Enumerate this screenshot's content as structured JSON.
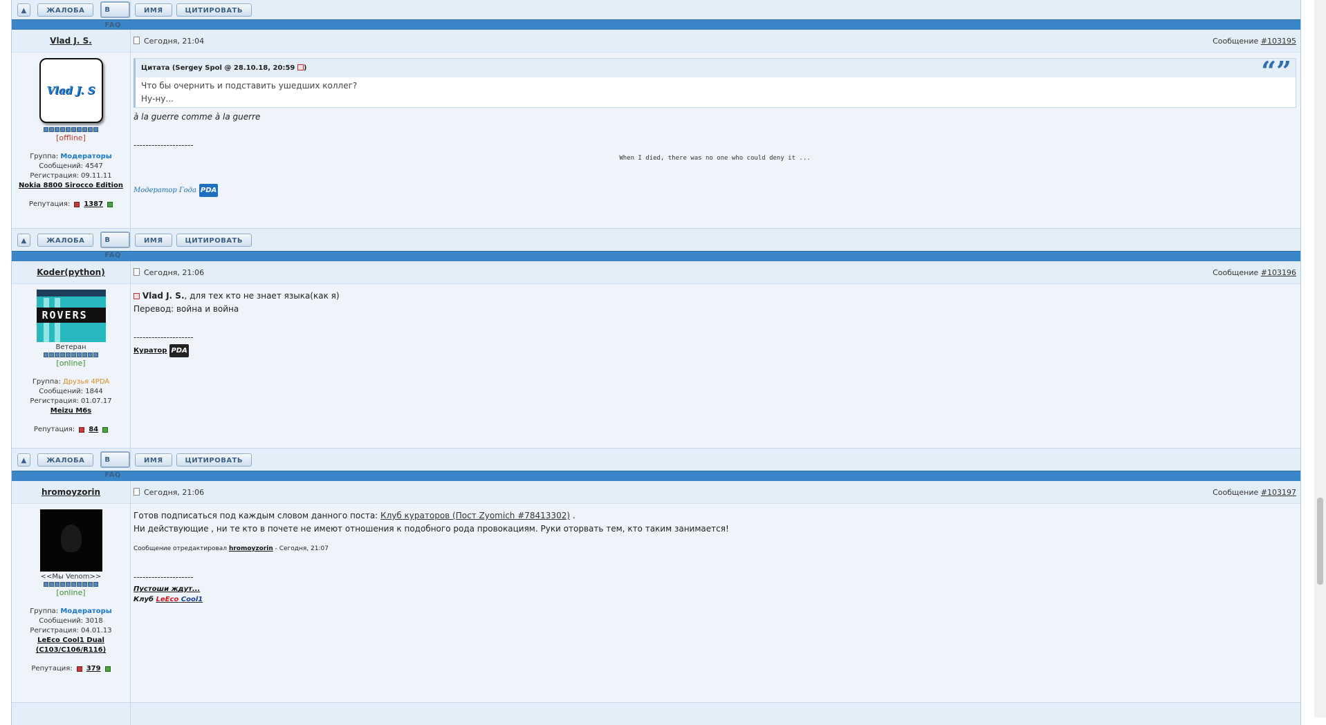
{
  "actions": {
    "up": "▲",
    "complain": "ЖАЛОБА",
    "faq": "В FAQ",
    "name": "ИМЯ",
    "quote": "ЦИТИРОВАТЬ"
  },
  "posts": [
    {
      "author": "Vlad J. S.",
      "date": "Сегодня, 21:04",
      "msg_label": "Сообщение",
      "msg_num": "#103195",
      "avatar_text": "Vlad J. S",
      "status": "[offline]",
      "group_label": "Группа:",
      "group": "Модераторы",
      "messages": "Сообщений: 4547",
      "registered": "Регистрация: 09.11.11",
      "device": "Nokia 8800 Sirocco Edition",
      "rep_label": "Репутация:",
      "rep": "1387",
      "quote_head": "Цитата (Sergey Spol @ 28.10.18, 20:59",
      "quote_line1": "Что бы очернить и подставить ушедших коллег?",
      "quote_line2": "Ну-ну...",
      "text": "à la guerre comme à la guerre",
      "sig_dash": "--------------------",
      "sig_quote": "When I died, there was no one who could deny it ...",
      "sig_mod": "Модератор Года",
      "sig_logo": "PDA"
    },
    {
      "author": "Koder(python)",
      "date": "Сегодня, 21:06",
      "msg_label": "Сообщение",
      "msg_num": "#103196",
      "avatar_text": "ROVERS",
      "title": "Ветеран",
      "status": "[online]",
      "group_label": "Группа:",
      "group": "Друзья 4PDA",
      "messages": "Сообщений: 1844",
      "registered": "Регистрация: 01.07.17",
      "device": "Meizu M6s",
      "rep_label": "Репутация:",
      "rep": "84",
      "mention": "Vlad J. S.",
      "text1": ", для тех кто не знает языка(как я)",
      "text2": "Перевод: война и война",
      "sig_dash": "--------------------",
      "sig_curator": "Куратор",
      "sig_logo": "PDA"
    },
    {
      "author": "hromoyzorin",
      "date": "Сегодня, 21:06",
      "msg_label": "Сообщение",
      "msg_num": "#103197",
      "title": "<<Мы Venom>>",
      "status": "[online]",
      "group_label": "Группа:",
      "group": "Модераторы",
      "messages": "Сообщений: 3018",
      "registered": "Регистрация: 04.01.13",
      "device": "LeEco Cool1 Dual (C103/C106/R116)",
      "rep_label": "Репутация:",
      "rep": "379",
      "text1_pre": "Готов подписаться под каждым словом данного поста:",
      "text1_link": "Клуб кураторов (Пост Zyomich #78413302)",
      "text1_post": ".",
      "text2": "Ни действующие , ни те кто в почете не имеют отношения к подобного рода провокациям. Руки оторвать тем, кто таким занимается!",
      "edited_pre": "Сообщение отредактировал",
      "edited_user": "hromoyzorin",
      "edited_post": "- Сегодня, 21:07",
      "sig_dash": "--------------------",
      "sig_line1": "Пустоши ждут...",
      "sig_line2_pre": "Клуб",
      "sig_line2_red": "LeEco",
      "sig_line2_blue": "Cool1"
    }
  ],
  "colors": {
    "separator": "#3b86c8",
    "moderator": "#1b7ac9",
    "friends": "#e08a1e",
    "online": "#3d8f2a",
    "offline": "#c0392b"
  }
}
